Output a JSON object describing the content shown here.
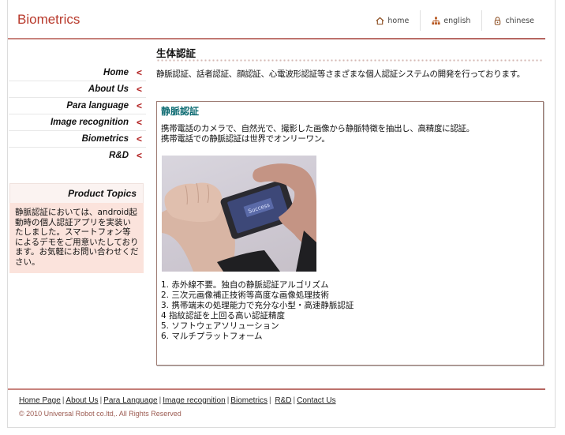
{
  "header": {
    "logo": "Biometrics",
    "topnav": [
      {
        "label": "home",
        "icon": "home-icon"
      },
      {
        "label": "english",
        "icon": "sitemap-icon"
      },
      {
        "label": "chinese",
        "icon": "lock-icon"
      }
    ]
  },
  "sidebar": {
    "items": [
      {
        "label": "Home"
      },
      {
        "label": "About Us"
      },
      {
        "label": "Para language"
      },
      {
        "label": "Image recognition"
      },
      {
        "label": "Biometrics"
      },
      {
        "label": "R&D"
      }
    ],
    "arrow": "<",
    "topics": {
      "title": "Product Topics",
      "body": "静脈認証においては、android起動時の個人認証アプリを実装いたしました。スマートフォン等によるデモをご用意いたしております。お気軽にお問い合わせください。"
    }
  },
  "main": {
    "title": "生体認証",
    "intro": "静脈認証、話者認証、顔認証、心電波形認証等さまざまな個人認証システムの開発を行っております。",
    "section": {
      "title": "静脈認証",
      "desc_lines": [
        "携帯電話のカメラで、自然光で、撮影した画像から静脈特徴を抽出し、高精度に認証。",
        "携帯電話での静脈認証は世界でオンリーワン。"
      ],
      "photo_alt": "wrist vein scan with smartphone",
      "phone_screen_text": "Success",
      "features": [
        "1. 赤外線不要。独自の静脈認証アルゴリズム",
        "2. 三次元画像補正技術等高度な画像処理技術",
        "3. 携帯端末の処理能力で充分な小型・高速静脈認証",
        "4  指紋認証を上回る高い認証精度",
        "5. ソフトウェアソリューション",
        "6. マルチプラットフォーム"
      ]
    }
  },
  "footer": {
    "links": [
      "Home Page",
      "About Us",
      "Para Language",
      "Image recognition",
      "Biometrics",
      "R&D",
      "Contact Us"
    ],
    "separator": "|",
    "copyright": "© 2010 Universal Robot co.ltd,. All Rights Reserved"
  },
  "colors": {
    "brand": "#b8392b",
    "accent_rule": "#b56560",
    "section_title": "#0e6b72",
    "topics_bg": "#fbe3dc",
    "nav_arrow": "#b01c1c"
  }
}
